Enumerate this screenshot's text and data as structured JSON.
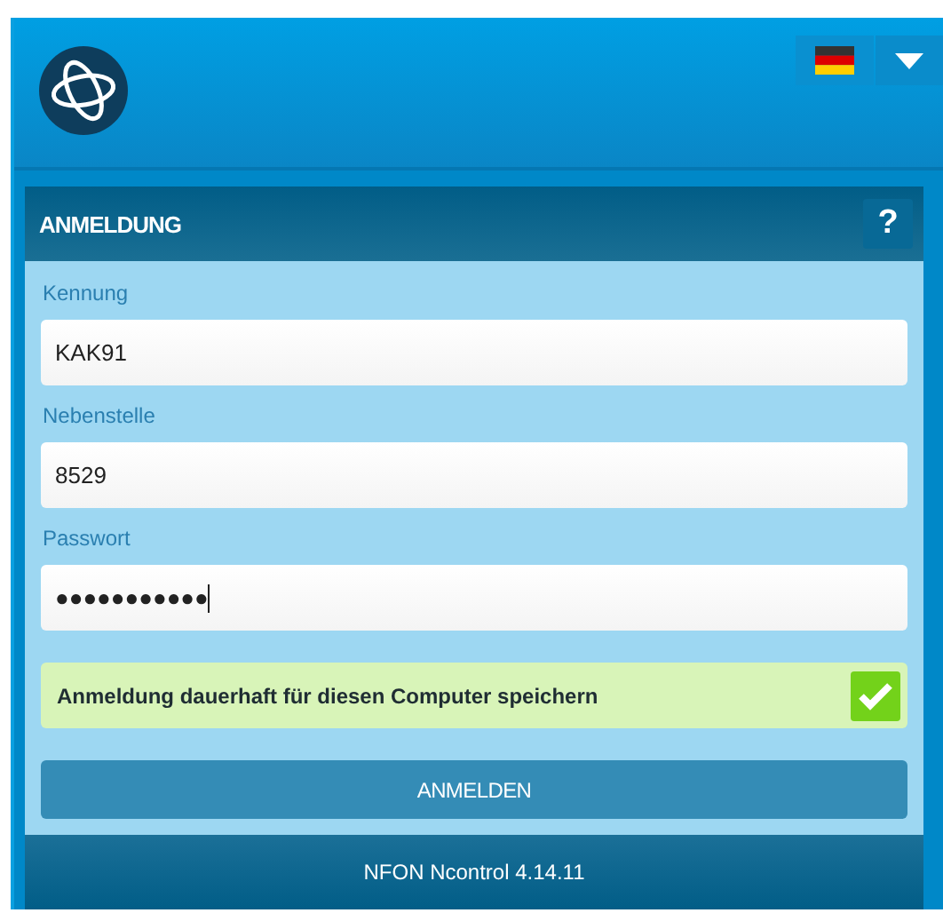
{
  "panel": {
    "title": "ANMELDUNG",
    "help": "?"
  },
  "fields": [
    {
      "label": "Kennung",
      "value": "KAK91",
      "focused": false
    },
    {
      "label": "Nebenstelle",
      "value": "8529",
      "focused": false
    },
    {
      "label": "Passwort",
      "value": "●●●●●●●●●●●",
      "focused": true
    }
  ],
  "remember": {
    "label": "Anmeldung dauerhaft für diesen Computer speichern",
    "checked": true
  },
  "submit": "ANMELDEN",
  "footer": "NFON Ncontrol 4.14.11"
}
